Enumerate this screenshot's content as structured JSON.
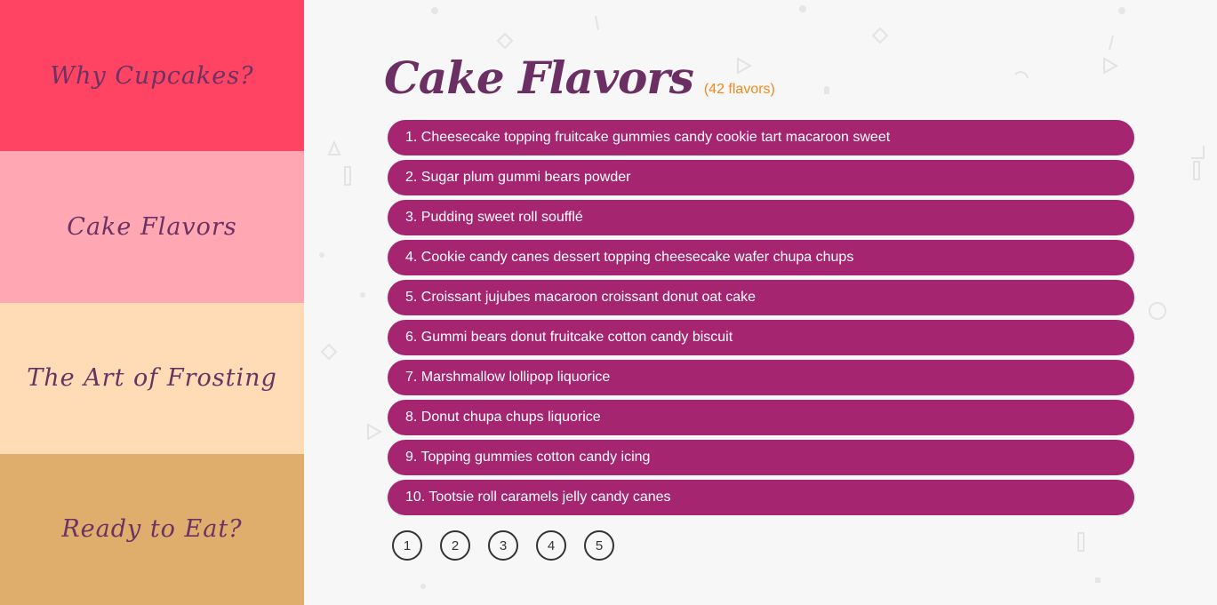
{
  "sidebar": {
    "items": [
      {
        "label": "Why Cupcakes?",
        "color": "#ff4463"
      },
      {
        "label": "Cake Flavors",
        "color": "#ffa7b2"
      },
      {
        "label": "The Art of Frosting",
        "color": "#ffdcb5"
      },
      {
        "label": "Ready to Eat?",
        "color": "#dfad6c"
      }
    ]
  },
  "main": {
    "title": "Cake Flavors",
    "count": "(42 flavors)",
    "items": [
      "1. Cheesecake topping fruitcake gummies candy cookie tart macaroon sweet",
      "2. Sugar plum gummi bears powder",
      "3. Pudding sweet roll soufflé",
      "4. Cookie candy canes dessert topping cheesecake wafer chupa chups",
      "5. Croissant jujubes macaroon croissant donut oat cake",
      "6. Gummi bears donut fruitcake cotton candy biscuit",
      "7. Marshmallow lollipop liquorice",
      "8. Donut chupa chups liquorice",
      "9. Topping gummies cotton candy icing",
      "10. Tootsie roll caramels jelly candy canes"
    ],
    "pages": [
      "1",
      "2",
      "3",
      "4",
      "5"
    ]
  },
  "colors": {
    "item_bg": "#a52570",
    "title": "#6b2f63",
    "count": "#f08a1c",
    "background": "#f7f7f7"
  }
}
